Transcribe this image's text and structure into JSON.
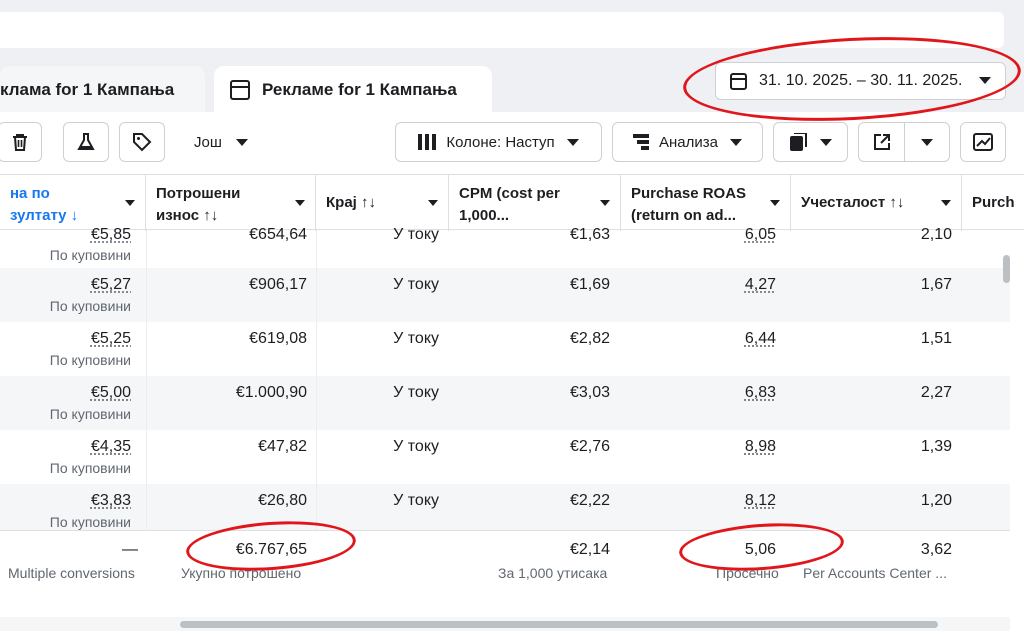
{
  "tabs": [
    {
      "label": "клама for 1 Кампања"
    },
    {
      "label": "Рекламе for 1 Кампања"
    }
  ],
  "date_range": {
    "label": "31. 10. 2025. – 30. 11. 2025."
  },
  "toolbar": {
    "more_label": "Још",
    "columns_label": "Колоне: Наступ",
    "analysis_label": "Анализа"
  },
  "columns": [
    {
      "line1": "на по",
      "line2": "зултату ↓"
    },
    {
      "line1": "Потрошени",
      "line2": "износ ↑↓"
    },
    {
      "line1": "Крај ↑↓",
      "line2": ""
    },
    {
      "line1": "CPM (cost per",
      "line2": "1,000..."
    },
    {
      "line1": "Purchase ROAS",
      "line2": "(return on ad..."
    },
    {
      "line1": "Учесталост ↑↓",
      "line2": ""
    },
    {
      "line1": "Purch",
      "line2": ""
    }
  ],
  "rows": [
    {
      "cpr": "€5,85",
      "cpr_sub": "По куповини",
      "spent": "€654,64",
      "end": "У току",
      "cpm": "€1,63",
      "roas": "6,05",
      "freq": "2,10"
    },
    {
      "cpr": "€5,27",
      "cpr_sub": "По куповини",
      "spent": "€906,17",
      "end": "У току",
      "cpm": "€1,69",
      "roas": "4,27",
      "freq": "1,67"
    },
    {
      "cpr": "€5,25",
      "cpr_sub": "По куповини",
      "spent": "€619,08",
      "end": "У току",
      "cpm": "€2,82",
      "roas": "6,44",
      "freq": "1,51"
    },
    {
      "cpr": "€5,00",
      "cpr_sub": "По куповини",
      "spent": "€1.000,90",
      "end": "У току",
      "cpm": "€3,03",
      "roas": "6,83",
      "freq": "2,27"
    },
    {
      "cpr": "€4,35",
      "cpr_sub": "По куповини",
      "spent": "€47,82",
      "end": "У току",
      "cpm": "€2,76",
      "roas": "8,98",
      "freq": "1,39"
    },
    {
      "cpr": "€3,83",
      "cpr_sub": "По куповини",
      "spent": "€26,80",
      "end": "У току",
      "cpm": "€2,22",
      "roas": "8,12",
      "freq": "1,20"
    }
  ],
  "summary": {
    "cpr": "—",
    "cpr_label": "Multiple conversions",
    "spent": "€6.767,65",
    "spent_label": "Укупно потрошено",
    "cpm": "€2,14",
    "cpm_label": "За 1,000 утисака",
    "roas": "5,06",
    "roas_label": "Просечно",
    "freq": "3,62",
    "freq_label": "Per Accounts Center ..."
  },
  "colors": {
    "annotation": "#e0161b",
    "link": "#1877f2"
  }
}
